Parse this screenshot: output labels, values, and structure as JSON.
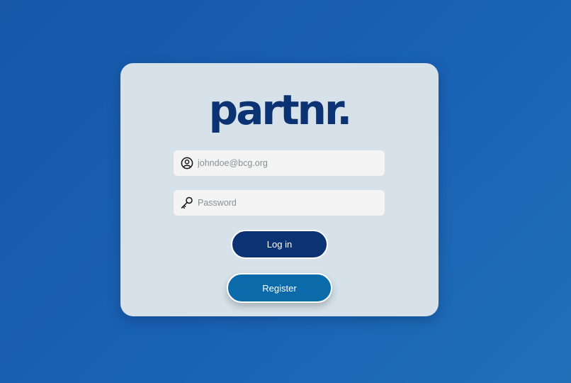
{
  "colors": {
    "background": "#1a5fb0",
    "card": "#d6e1e9",
    "brand": "#0b3373",
    "login_button": "#0b3373",
    "register_button": "#0a6aaa",
    "field": "#f4f4f4"
  },
  "logo": {
    "text": "partnr."
  },
  "form": {
    "email": {
      "icon": "user-circle-icon",
      "placeholder": "johndoe@bcg.org",
      "value": ""
    },
    "password": {
      "icon": "key-icon",
      "placeholder": "Password",
      "value": ""
    },
    "login_label": "Log in",
    "register_label": "Register"
  }
}
